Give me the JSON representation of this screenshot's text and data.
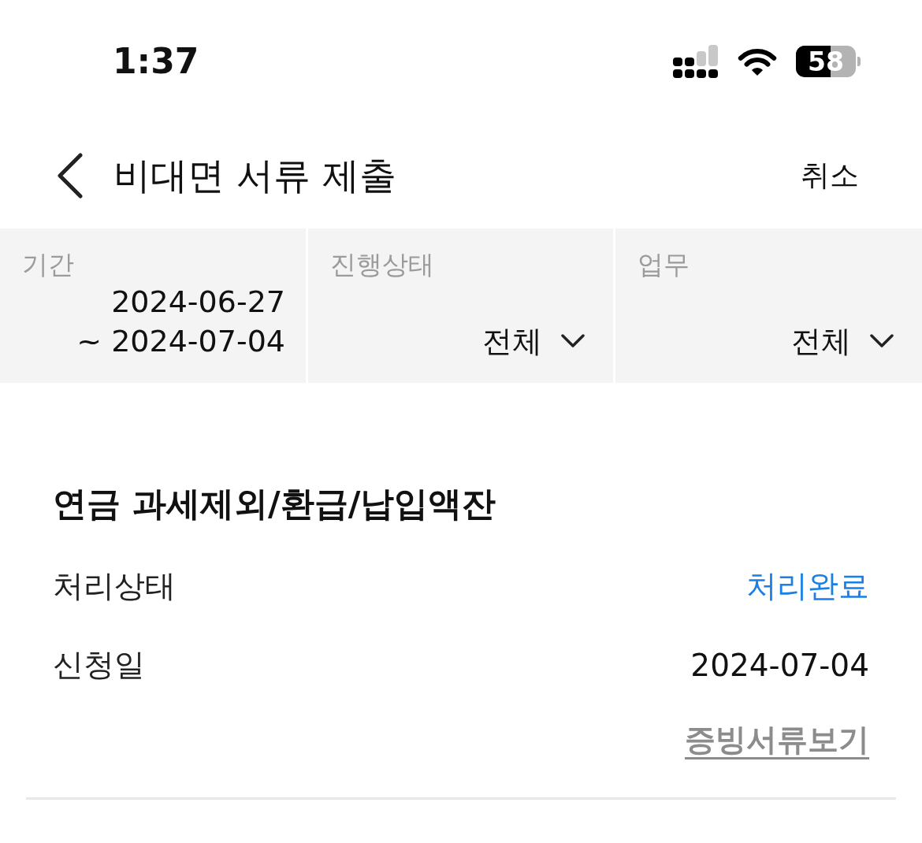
{
  "status_bar": {
    "time": "1:37",
    "battery": "58"
  },
  "header": {
    "title": "비대면 서류 제출",
    "action": "취소"
  },
  "filters": [
    {
      "kind": "range",
      "label": "기간",
      "from": "2024-06-27",
      "to": "~ 2024-07-04"
    },
    {
      "kind": "select",
      "label": "진행상태",
      "value": "전체"
    },
    {
      "kind": "select",
      "label": "업무",
      "value": "전체"
    }
  ],
  "records": [
    {
      "title": "연금 과세제외/환급/납입액잔",
      "fields": [
        {
          "kind": "status",
          "label": "처리상태",
          "value": "처리완료"
        },
        {
          "kind": "plain",
          "label": "신청일",
          "value": "2024-07-04"
        }
      ],
      "link": "증빙서류보기"
    }
  ]
}
